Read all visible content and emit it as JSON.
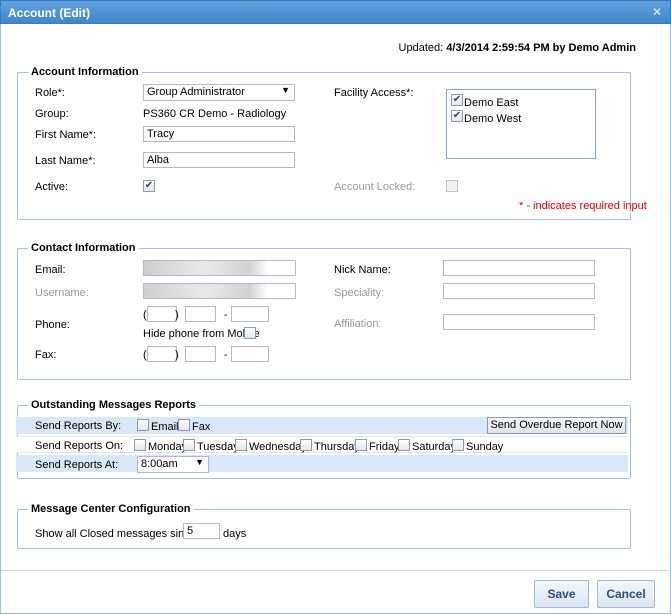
{
  "window": {
    "title": "Account (Edit)",
    "close_glyph": "✕"
  },
  "updated": {
    "prefix": "Updated:",
    "value": "4/3/2014 2:59:54 PM by Demo Admin"
  },
  "account": {
    "legend": "Account Information",
    "role_label": "Role*:",
    "role_value": "Group Administrator",
    "group_label": "Group:",
    "group_value": "PS360 CR Demo - Radiology",
    "first_name_label": "First Name*:",
    "first_name_value": "Tracy",
    "last_name_label": "Last Name*:",
    "last_name_value": "Alba",
    "active_label": "Active:",
    "active_checked": true,
    "facility_label": "Facility Access*:",
    "facilities": [
      {
        "label": "Demo East",
        "checked": true
      },
      {
        "label": "Demo West",
        "checked": true
      }
    ],
    "locked_label": "Account Locked:",
    "locked_checked": false,
    "required_note": "* - indicates required input"
  },
  "contact": {
    "legend": "Contact Information",
    "email_label": "Email:",
    "username_label": "Username:",
    "phone_label": "Phone:",
    "hide_phone_label": "Hide phone from Mobile",
    "fax_label": "Fax:",
    "nick_label": "Nick Name:",
    "speciality_label": "Speciality:",
    "affiliation_label": "Affiliation:",
    "paren_open": "(",
    "paren_close": ")",
    "dash": "-"
  },
  "outstanding": {
    "legend": "Outstanding Messages Reports",
    "send_by_label": "Send Reports By:",
    "email_label": "Email",
    "fax_label": "Fax",
    "overdue_button": "Send Overdue Report Now",
    "send_on_label": "Send Reports On:",
    "days": [
      "Monday",
      "Tuesday",
      "Wednesday",
      "Thursday",
      "Friday",
      "Saturday",
      "Sunday"
    ],
    "send_at_label": "Send Reports At:",
    "send_at_value": "8:00am"
  },
  "message_center": {
    "legend": "Message Center Configuration",
    "prefix": "Show all Closed messages since last",
    "days_value": "5",
    "suffix": "days"
  },
  "footer": {
    "save": "Save",
    "cancel": "Cancel"
  },
  "colors": {
    "title_bar": "#4a90d4",
    "required": "#e00000",
    "band": "#d9e8f7"
  }
}
